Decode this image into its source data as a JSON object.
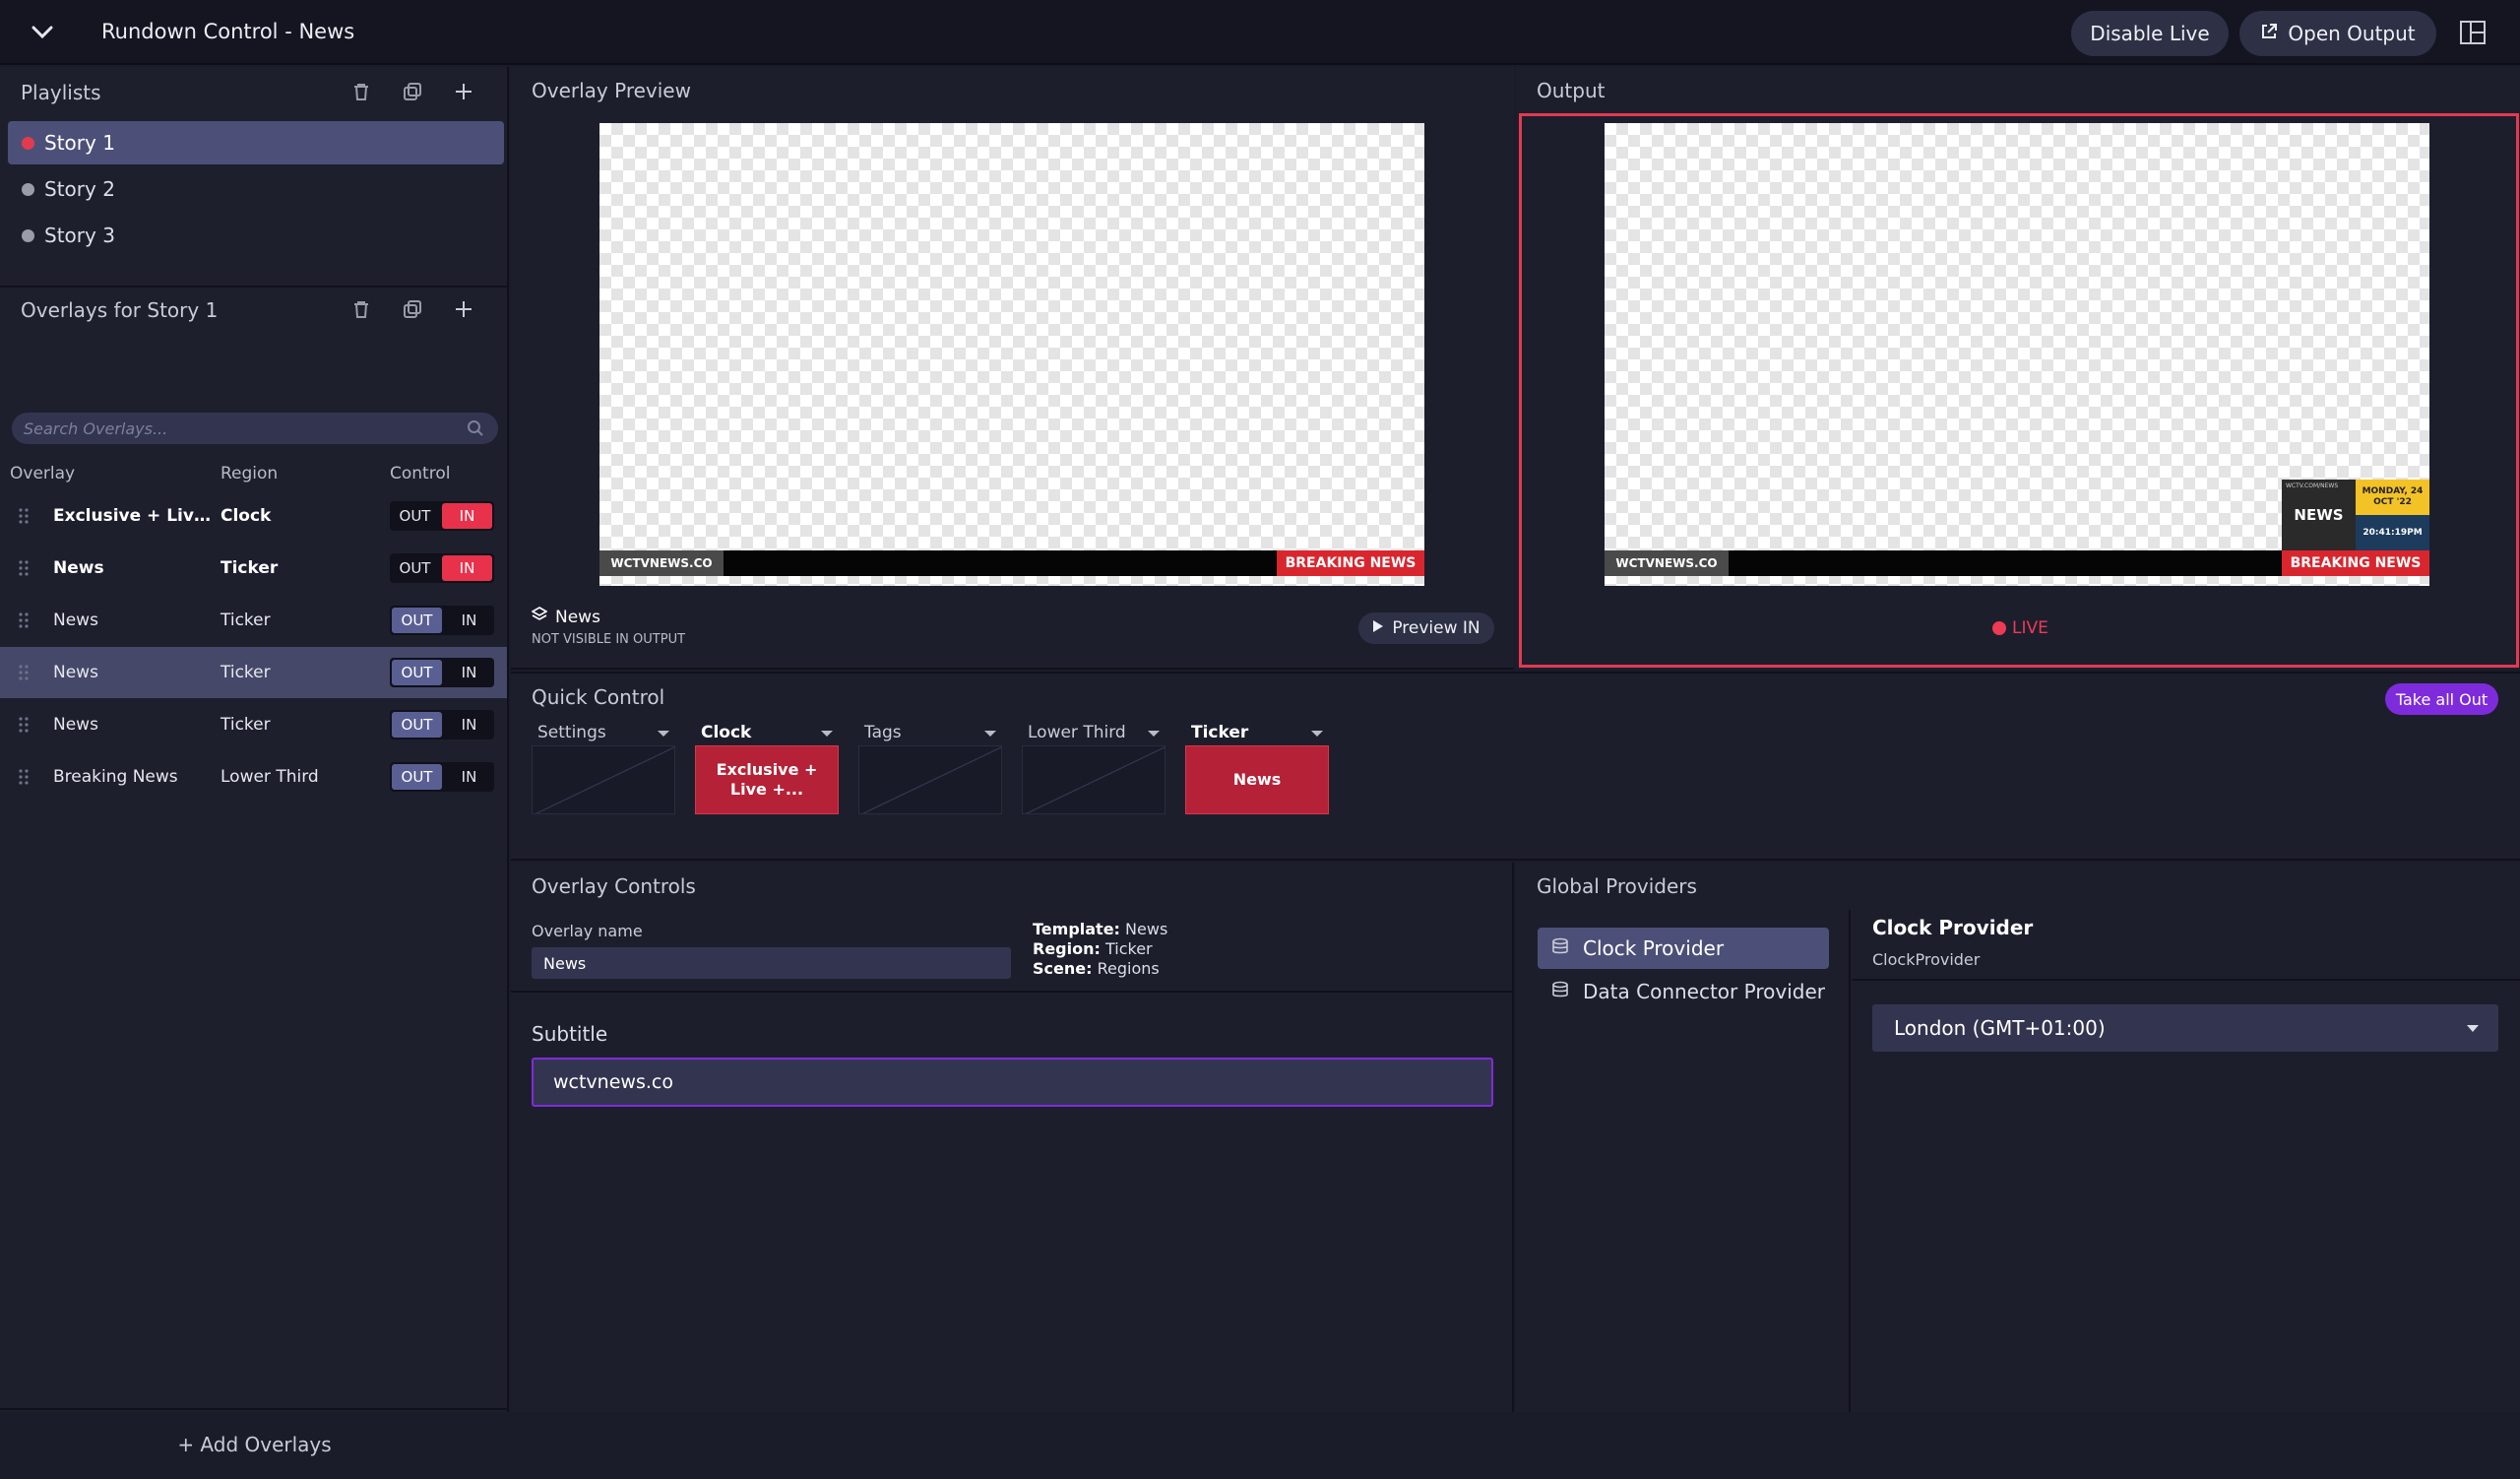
{
  "app": {
    "title": "Rundown Control - News"
  },
  "topbar": {
    "disable_live": "Disable Live",
    "open_output": "Open Output"
  },
  "playlists": {
    "title": "Playlists",
    "items": [
      {
        "label": "Story 1",
        "active": true
      },
      {
        "label": "Story 2",
        "active": false
      },
      {
        "label": "Story 3",
        "active": false
      }
    ]
  },
  "overlays": {
    "title": "Overlays for Story 1",
    "search_placeholder": "Search Overlays...",
    "columns": [
      "Overlay",
      "Region",
      "Control"
    ],
    "rows": [
      {
        "name": "Exclusive + Live ...",
        "region": "Clock",
        "out": "OUT",
        "in": "IN",
        "state": "in",
        "bold": true
      },
      {
        "name": "News",
        "region": "Ticker",
        "out": "OUT",
        "in": "IN",
        "state": "in",
        "bold": true
      },
      {
        "name": "News",
        "region": "Ticker",
        "out": "OUT",
        "in": "IN",
        "state": "out",
        "bold": false
      },
      {
        "name": "News",
        "region": "Ticker",
        "out": "OUT",
        "in": "IN",
        "state": "out",
        "bold": false
      },
      {
        "name": "News",
        "region": "Ticker",
        "out": "OUT",
        "in": "IN",
        "state": "out",
        "bold": false
      },
      {
        "name": "Breaking News",
        "region": "Lower Third",
        "out": "OUT",
        "in": "IN",
        "state": "out",
        "bold": false
      }
    ],
    "add_label": "+ Add Overlays"
  },
  "preview": {
    "title": "Overlay Preview",
    "ticker_site": "WCTVNEWS.CO",
    "ticker_breaking": "BREAKING NEWS",
    "overlay_name": "News",
    "visibility": "NOT VISIBLE IN OUTPUT",
    "preview_btn": "Preview IN"
  },
  "output": {
    "title": "Output",
    "ticker_site": "WCTVNEWS.CO",
    "ticker_breaking": "BREAKING NEWS",
    "clock_logo_top": "WCTV.COM/NEWS",
    "clock_logo": "NEWS",
    "clock_date_line1": "MONDAY, 24",
    "clock_date_line2": "OCT '22",
    "clock_time": "20:41:19PM",
    "live_label": "LIVE"
  },
  "quick_control": {
    "title": "Quick Control",
    "take_all_out": "Take all Out",
    "columns": [
      {
        "label": "Settings",
        "active": false,
        "content": ""
      },
      {
        "label": "Clock",
        "active": true,
        "content": "Exclusive + Live +..."
      },
      {
        "label": "Tags",
        "active": false,
        "content": ""
      },
      {
        "label": "Lower Third",
        "active": false,
        "content": ""
      },
      {
        "label": "Ticker",
        "active": true,
        "content": "News"
      }
    ]
  },
  "overlay_controls": {
    "title": "Overlay Controls",
    "name_label": "Overlay name",
    "name_value": "News",
    "template_key": "Template:",
    "template_val": "News",
    "region_key": "Region:",
    "region_val": "Ticker",
    "scene_key": "Scene:",
    "scene_val": "Regions",
    "subtitle_label": "Subtitle",
    "subtitle_value": "wctvnews.co"
  },
  "global_providers": {
    "title": "Global Providers",
    "items": [
      {
        "label": "Clock Provider",
        "active": true
      },
      {
        "label": "Data Connector Provider",
        "active": false
      }
    ],
    "detail_title": "Clock Provider",
    "detail_sub": "ClockProvider",
    "timezone": "London (GMT+01:00)"
  },
  "colors": {
    "accent": "#7e2bdc",
    "live": "#e8324c",
    "selected": "#4c5078"
  }
}
